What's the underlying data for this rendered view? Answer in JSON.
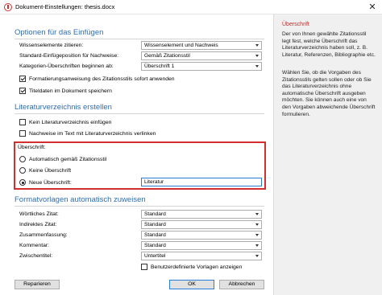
{
  "window": {
    "title": "Dokument-Einstellungen: thesis.docx",
    "close_glyph": "✕",
    "app_icon": "alert-circle-icon"
  },
  "insert_options": {
    "heading": "Optionen für das Einfügen",
    "rows": [
      {
        "label": "Wissenselemente zitieren:",
        "value": "Wissenselement und Nachweis"
      },
      {
        "label": "Standard-Einfügeposition für Nachweise:",
        "value": "Gemäß Zitationsstil"
      },
      {
        "label": "Kategorien-Überschriften beginnen ab:",
        "value": "Überschrift 1"
      }
    ],
    "checkbox_format": {
      "label": "Formatierungsanweisung des Zitationsstils sofort anwenden",
      "checked": true
    },
    "checkbox_save": {
      "label": "Titeldaten im Dokument speichern",
      "checked": true
    }
  },
  "bibliography": {
    "heading": "Literaturverzeichnis erstellen",
    "checkbox_none": {
      "label": "Kein Literaturverzeichnis einfügen",
      "checked": false
    },
    "checkbox_link": {
      "label": "Nachweise im Text mit Literaturverzeichnis verlinken",
      "checked": false
    },
    "heading_group_label": "Überschrift:",
    "radio_auto": {
      "label": "Automatisch gemäß Zitationsstil",
      "checked": false
    },
    "radio_none": {
      "label": "Keine Überschrift",
      "checked": false
    },
    "radio_new": {
      "label": "Neue Überschrift:",
      "checked": true
    },
    "new_heading_value": "Literatur"
  },
  "styles": {
    "heading": "Formatvorlagen automatisch zuweisen",
    "rows": [
      {
        "label": "Wörtliches Zitat:",
        "value": "Standard"
      },
      {
        "label": "Indirektes Zitat:",
        "value": "Standard"
      },
      {
        "label": "Zusammenfassung:",
        "value": "Standard"
      },
      {
        "label": "Kommentar:",
        "value": "Standard"
      },
      {
        "label": "Zwischentitel:",
        "value": "Untertitel"
      }
    ],
    "checkbox_custom": {
      "label": "Benutzerdefinierte Vorlagen anzeigen",
      "checked": false
    }
  },
  "buttons": {
    "repair": "Reparieren",
    "ok": "OK",
    "cancel": "Abbrechen"
  },
  "help": {
    "title": "Überschrift",
    "p1": "Der von Ihnen gewählte Zitationsstil legt fest, welche Überschrift das Literaturverzeichnis haben soll, z. B. Literatur, Referenzen, Bibliographie etc.",
    "p2": "Wählen Sie, ob die Vorgaben des Zitationsstils gelten sollen oder ob Sie das Literaturverzeichnis ohne automatische Überschrift ausgeben möchten. Sie können auch eine von den Vorgaben abweichende Überschrift formulieren."
  },
  "colors": {
    "accent_heading": "#2f6db5",
    "highlight": "#d32f2f",
    "help_title": "#c62828"
  }
}
